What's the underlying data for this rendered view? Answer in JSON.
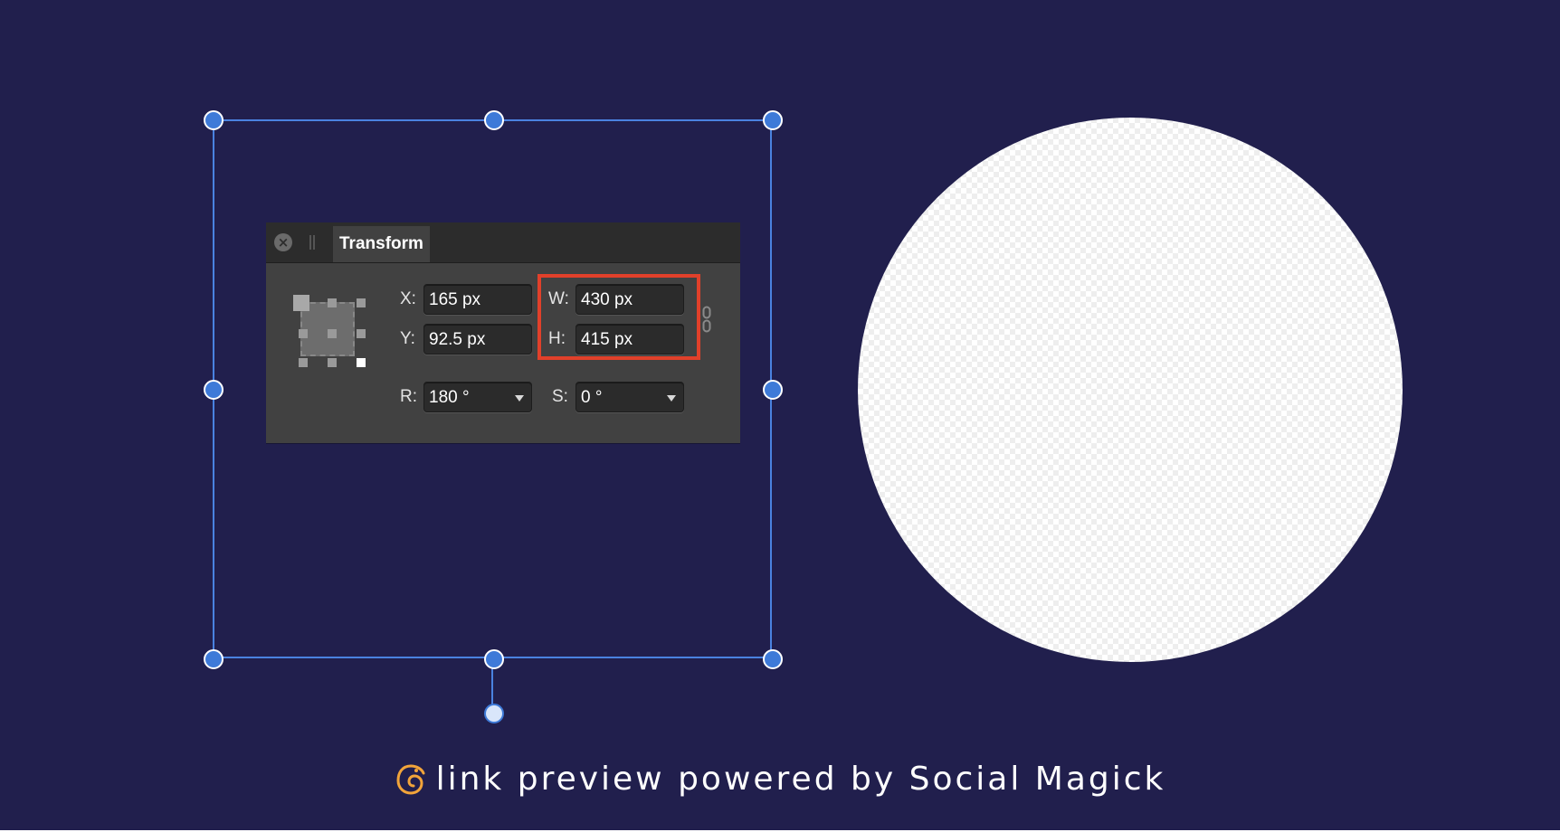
{
  "panel": {
    "tab_label": "Transform",
    "close_symbol": "×",
    "fields": {
      "x": {
        "label": "X:",
        "value": "165 px"
      },
      "y": {
        "label": "Y:",
        "value": "92.5 px"
      },
      "w": {
        "label": "W:",
        "value": "430 px"
      },
      "h": {
        "label": "H:",
        "value": "415 px"
      },
      "r": {
        "label": "R:",
        "value": "180 °"
      },
      "s": {
        "label": "S:",
        "value": "0 °"
      }
    },
    "anchor_selected": "bottom-right",
    "link_icon": "chain-link-icon"
  },
  "footer": {
    "text": "link preview powered by Social Magick",
    "logo_icon": "chameleon-logo-icon"
  },
  "colors": {
    "background": "#211f4d",
    "selection": "#4a82e0",
    "highlight": "#e1402a",
    "logo": "#f2a43a"
  }
}
